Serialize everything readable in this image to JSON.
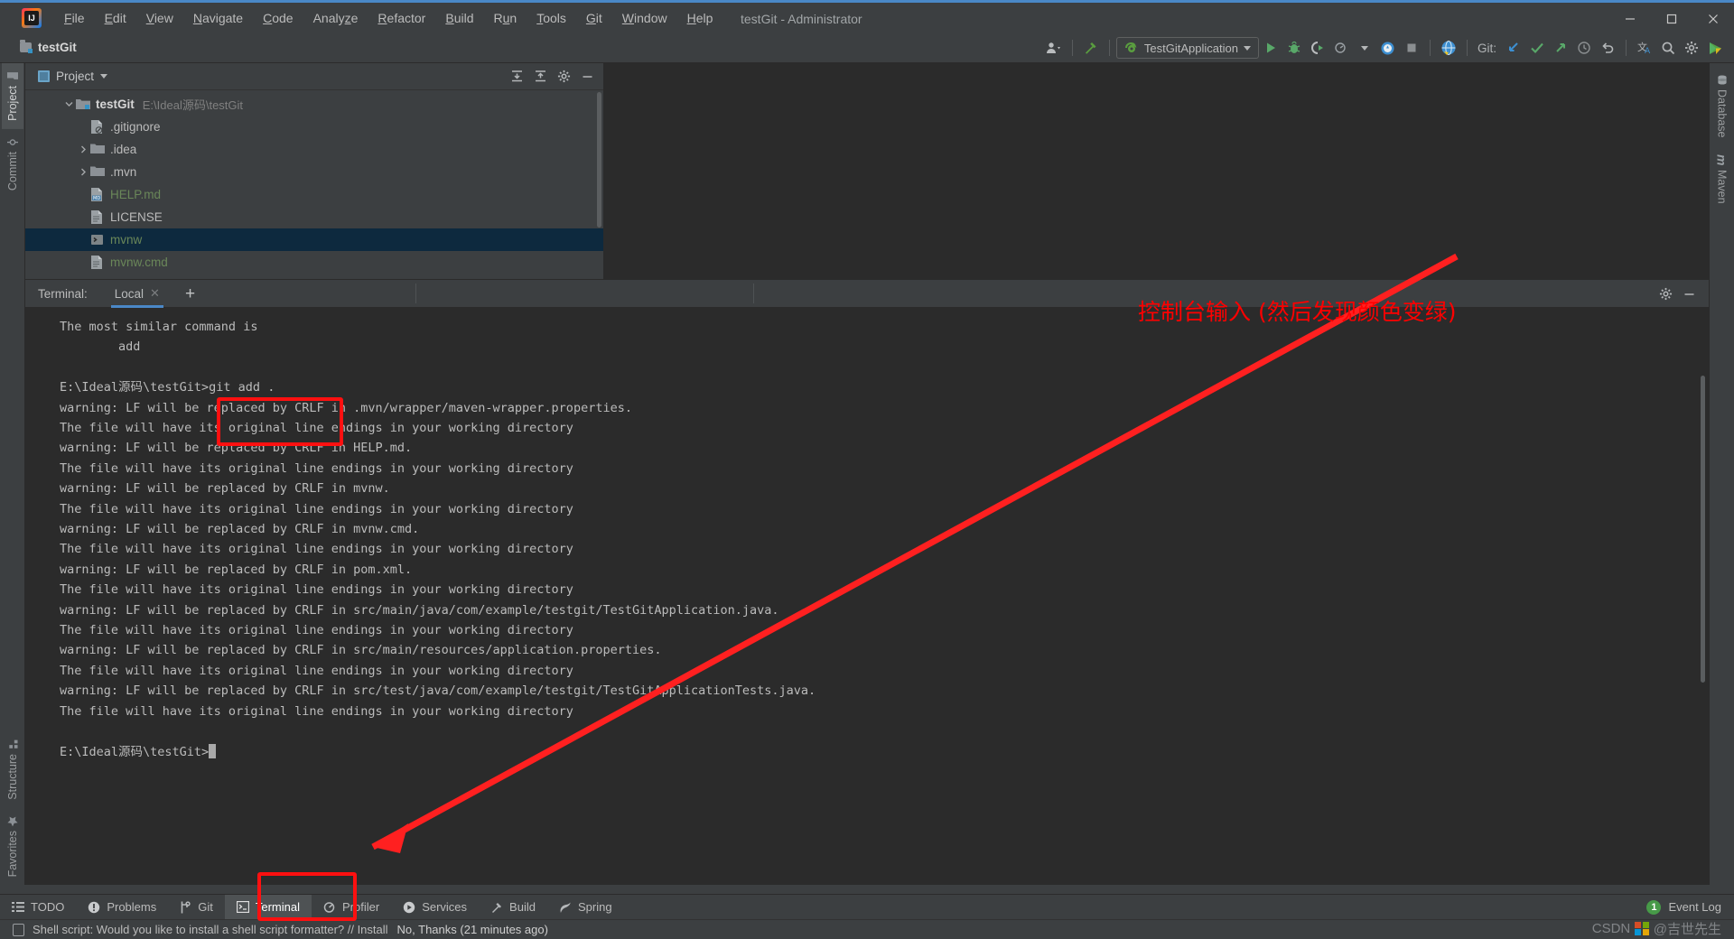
{
  "window": {
    "title": "testGit - Administrator",
    "minimize": "–",
    "maximize": "□",
    "close": "✕"
  },
  "menubar": {
    "items": [
      {
        "label": "File",
        "mnemonic": "F"
      },
      {
        "label": "Edit",
        "mnemonic": "E"
      },
      {
        "label": "View",
        "mnemonic": "V"
      },
      {
        "label": "Navigate",
        "mnemonic": "N"
      },
      {
        "label": "Code",
        "mnemonic": "C"
      },
      {
        "label": "Analyze",
        "mnemonic": "z"
      },
      {
        "label": "Refactor",
        "mnemonic": "R"
      },
      {
        "label": "Build",
        "mnemonic": "B"
      },
      {
        "label": "Run",
        "mnemonic": "u"
      },
      {
        "label": "Tools",
        "mnemonic": "T"
      },
      {
        "label": "Git",
        "mnemonic": "G"
      },
      {
        "label": "Window",
        "mnemonic": "W"
      },
      {
        "label": "Help",
        "mnemonic": "H"
      }
    ]
  },
  "toolbar": {
    "project_name": "testGit",
    "run_configuration": "TestGitApplication",
    "git_label": "Git:",
    "icons": [
      "user-settings-icon",
      "build-hammer-icon",
      "run-icon",
      "debug-icon",
      "run-coverage-icon",
      "profile-icon",
      "stop-icon",
      "search-everywhere-globe-icon",
      "git-update-icon",
      "git-commit-icon",
      "git-push-icon",
      "git-history-icon",
      "git-rollback-icon",
      "translate-icon",
      "search-icon",
      "settings-gear-icon",
      "plugin-icon"
    ]
  },
  "left_rail": {
    "top": [
      {
        "label": "Project",
        "icon": "project-folder-icon",
        "active": true
      },
      {
        "label": "Commit",
        "icon": "commit-icon",
        "active": false
      }
    ],
    "bottom": [
      {
        "label": "Structure",
        "icon": "structure-icon",
        "active": false
      },
      {
        "label": "Favorites",
        "icon": "favorites-star-icon",
        "active": false
      }
    ]
  },
  "right_rail": {
    "items": [
      {
        "label": "Database",
        "icon": "database-icon"
      },
      {
        "label": "Maven",
        "icon": "maven-m-icon"
      }
    ]
  },
  "project_panel": {
    "title": "Project",
    "tools": [
      "expand-all-icon",
      "collapse-all-icon",
      "settings-gear-icon",
      "hide-minimize-icon"
    ],
    "tree": [
      {
        "label": "testGit",
        "path": "E:\\Ideal源码\\testGit",
        "icon": "module-folder-icon",
        "indent": 0,
        "twisty": "expanded",
        "bold": true,
        "selected": false,
        "color": "default"
      },
      {
        "label": ".gitignore",
        "path": "",
        "icon": "gitignore-file-icon",
        "indent": 1,
        "twisty": "none",
        "bold": false,
        "selected": false,
        "color": "default"
      },
      {
        "label": ".idea",
        "path": "",
        "icon": "folder-icon",
        "indent": 1,
        "twisty": "collapsed",
        "bold": false,
        "selected": false,
        "color": "default"
      },
      {
        "label": ".mvn",
        "path": "",
        "icon": "folder-icon",
        "indent": 1,
        "twisty": "collapsed",
        "bold": false,
        "selected": false,
        "color": "default"
      },
      {
        "label": "HELP.md",
        "path": "",
        "icon": "markdown-file-icon",
        "indent": 1,
        "twisty": "none",
        "bold": false,
        "selected": false,
        "color": "green"
      },
      {
        "label": "LICENSE",
        "path": "",
        "icon": "text-file-icon",
        "indent": 1,
        "twisty": "none",
        "bold": false,
        "selected": false,
        "color": "default"
      },
      {
        "label": "mvnw",
        "path": "",
        "icon": "shell-script-icon",
        "indent": 1,
        "twisty": "none",
        "bold": false,
        "selected": true,
        "color": "green"
      },
      {
        "label": "mvnw.cmd",
        "path": "",
        "icon": "cmd-file-icon",
        "indent": 1,
        "twisty": "none",
        "bold": false,
        "selected": false,
        "color": "green"
      }
    ]
  },
  "terminal": {
    "label": "Terminal:",
    "tab_name": "Local",
    "tab_close": "✕",
    "add_tab": "+",
    "header_icons": [
      "settings-gear-icon",
      "hide-minimize-icon"
    ],
    "lines": [
      "The most similar command is",
      "        add",
      "",
      "E:\\Ideal源码\\testGit>git add .",
      "warning: LF will be replaced by CRLF in .mvn/wrapper/maven-wrapper.properties.",
      "The file will have its original line endings in your working directory",
      "warning: LF will be replaced by CRLF in HELP.md.",
      "The file will have its original line endings in your working directory",
      "warning: LF will be replaced by CRLF in mvnw.",
      "The file will have its original line endings in your working directory",
      "warning: LF will be replaced by CRLF in mvnw.cmd.",
      "The file will have its original line endings in your working directory",
      "warning: LF will be replaced by CRLF in pom.xml.",
      "The file will have its original line endings in your working directory",
      "warning: LF will be replaced by CRLF in src/main/java/com/example/testgit/TestGitApplication.java.",
      "The file will have its original line endings in your working directory",
      "warning: LF will be replaced by CRLF in src/main/resources/application.properties.",
      "The file will have its original line endings in your working directory",
      "warning: LF will be replaced by CRLF in src/test/java/com/example/testgit/TestGitApplicationTests.java.",
      "The file will have its original line endings in your working directory",
      ""
    ],
    "prompt": "E:\\Ideal源码\\testGit>"
  },
  "bottom_bar": {
    "items": [
      {
        "label": "TODO",
        "icon": "todo-list-icon",
        "active": false
      },
      {
        "label": "Problems",
        "icon": "problems-warning-icon",
        "active": false
      },
      {
        "label": "Git",
        "icon": "git-branch-icon",
        "active": false
      },
      {
        "label": "Terminal",
        "icon": "terminal-prompt-icon",
        "active": true
      },
      {
        "label": "Profiler",
        "icon": "profiler-icon",
        "active": false
      },
      {
        "label": "Services",
        "icon": "services-play-icon",
        "active": false
      },
      {
        "label": "Build",
        "icon": "build-hammer-icon",
        "active": false
      },
      {
        "label": "Spring",
        "icon": "spring-leaf-icon",
        "active": false
      }
    ],
    "event_log": {
      "label": "Event Log",
      "count": "1"
    }
  },
  "status_bar": {
    "icon": "notification-balloon-icon",
    "message": "Shell script: Would you like to install a shell script formatter? // Install",
    "action": "No, Thanks (21 minutes ago)"
  },
  "annotations": {
    "note_text": "控制台输入 (然后发现颜色变绿)",
    "note_color": "#ff0000",
    "box_color": "#ff1010",
    "arrow_color": "#ff2020"
  },
  "watermark": {
    "text_left": "CSDN",
    "text_right": "@吉世先生"
  },
  "colors": {
    "accent_blue": "#4a88c7",
    "panel_bg": "#3c3f41",
    "terminal_bg": "#2b2b2b",
    "selection_bg": "#0d293e",
    "green_file": "#6a8759",
    "annotation_red": "#ff0000"
  }
}
